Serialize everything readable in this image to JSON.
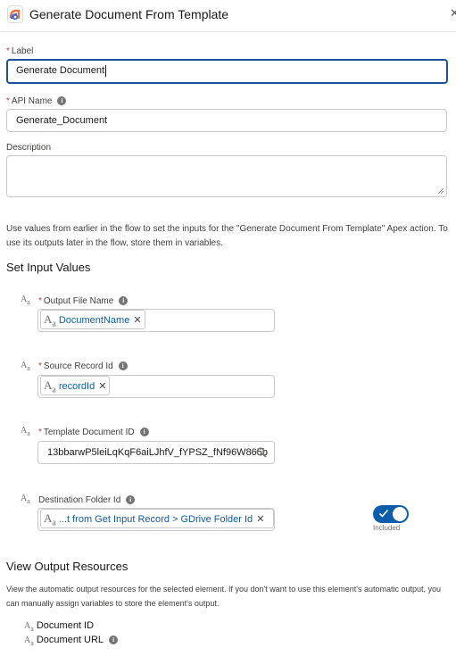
{
  "header": {
    "title": "Generate Document From Template",
    "close_icon": "close-icon",
    "app_icon": "generate-document-app-icon"
  },
  "label_field": {
    "label": "Label",
    "required_mark": "*",
    "value": "Generate Document"
  },
  "api_name_field": {
    "label": "API Name",
    "required_mark": "*",
    "value": "Generate_Document"
  },
  "description_field": {
    "label": "Description",
    "value": ""
  },
  "help_text": "Use values from earlier in the flow to set the inputs for the \"Generate Document From Template\" Apex action. To use its outputs later in the flow, store them in variables.",
  "set_input": {
    "title": "Set Input Values",
    "type_icon_main": "A",
    "type_icon_sub": "a",
    "fields": [
      {
        "label": "Output File Name",
        "required_mark": "*",
        "pill_value": "DocumentName"
      },
      {
        "label": "Source Record Id",
        "required_mark": "*",
        "pill_value": "recordId"
      },
      {
        "label": "Template Document ID",
        "required_mark": "*",
        "value": "13bbarwP5leiLqKqF6aiLJhfV_fYPSZ_fNf96W865b"
      },
      {
        "label": "Destination Folder Id",
        "pill_value": "...t from Get Input Record > GDrive Folder Id",
        "toggle_label": "Included",
        "toggle_on": true
      }
    ]
  },
  "output": {
    "title": "View Output Resources",
    "help_text": "View the automatic output resources for the selected element. If you don't want to use this element's automatic output, you can manually assign variables to store the element's output.",
    "items": [
      {
        "label": "Document ID"
      },
      {
        "label": "Document URL"
      }
    ]
  },
  "colors": {
    "accent": "#0b5cab",
    "focus_border": "#1b5297",
    "required": "#c23934"
  }
}
